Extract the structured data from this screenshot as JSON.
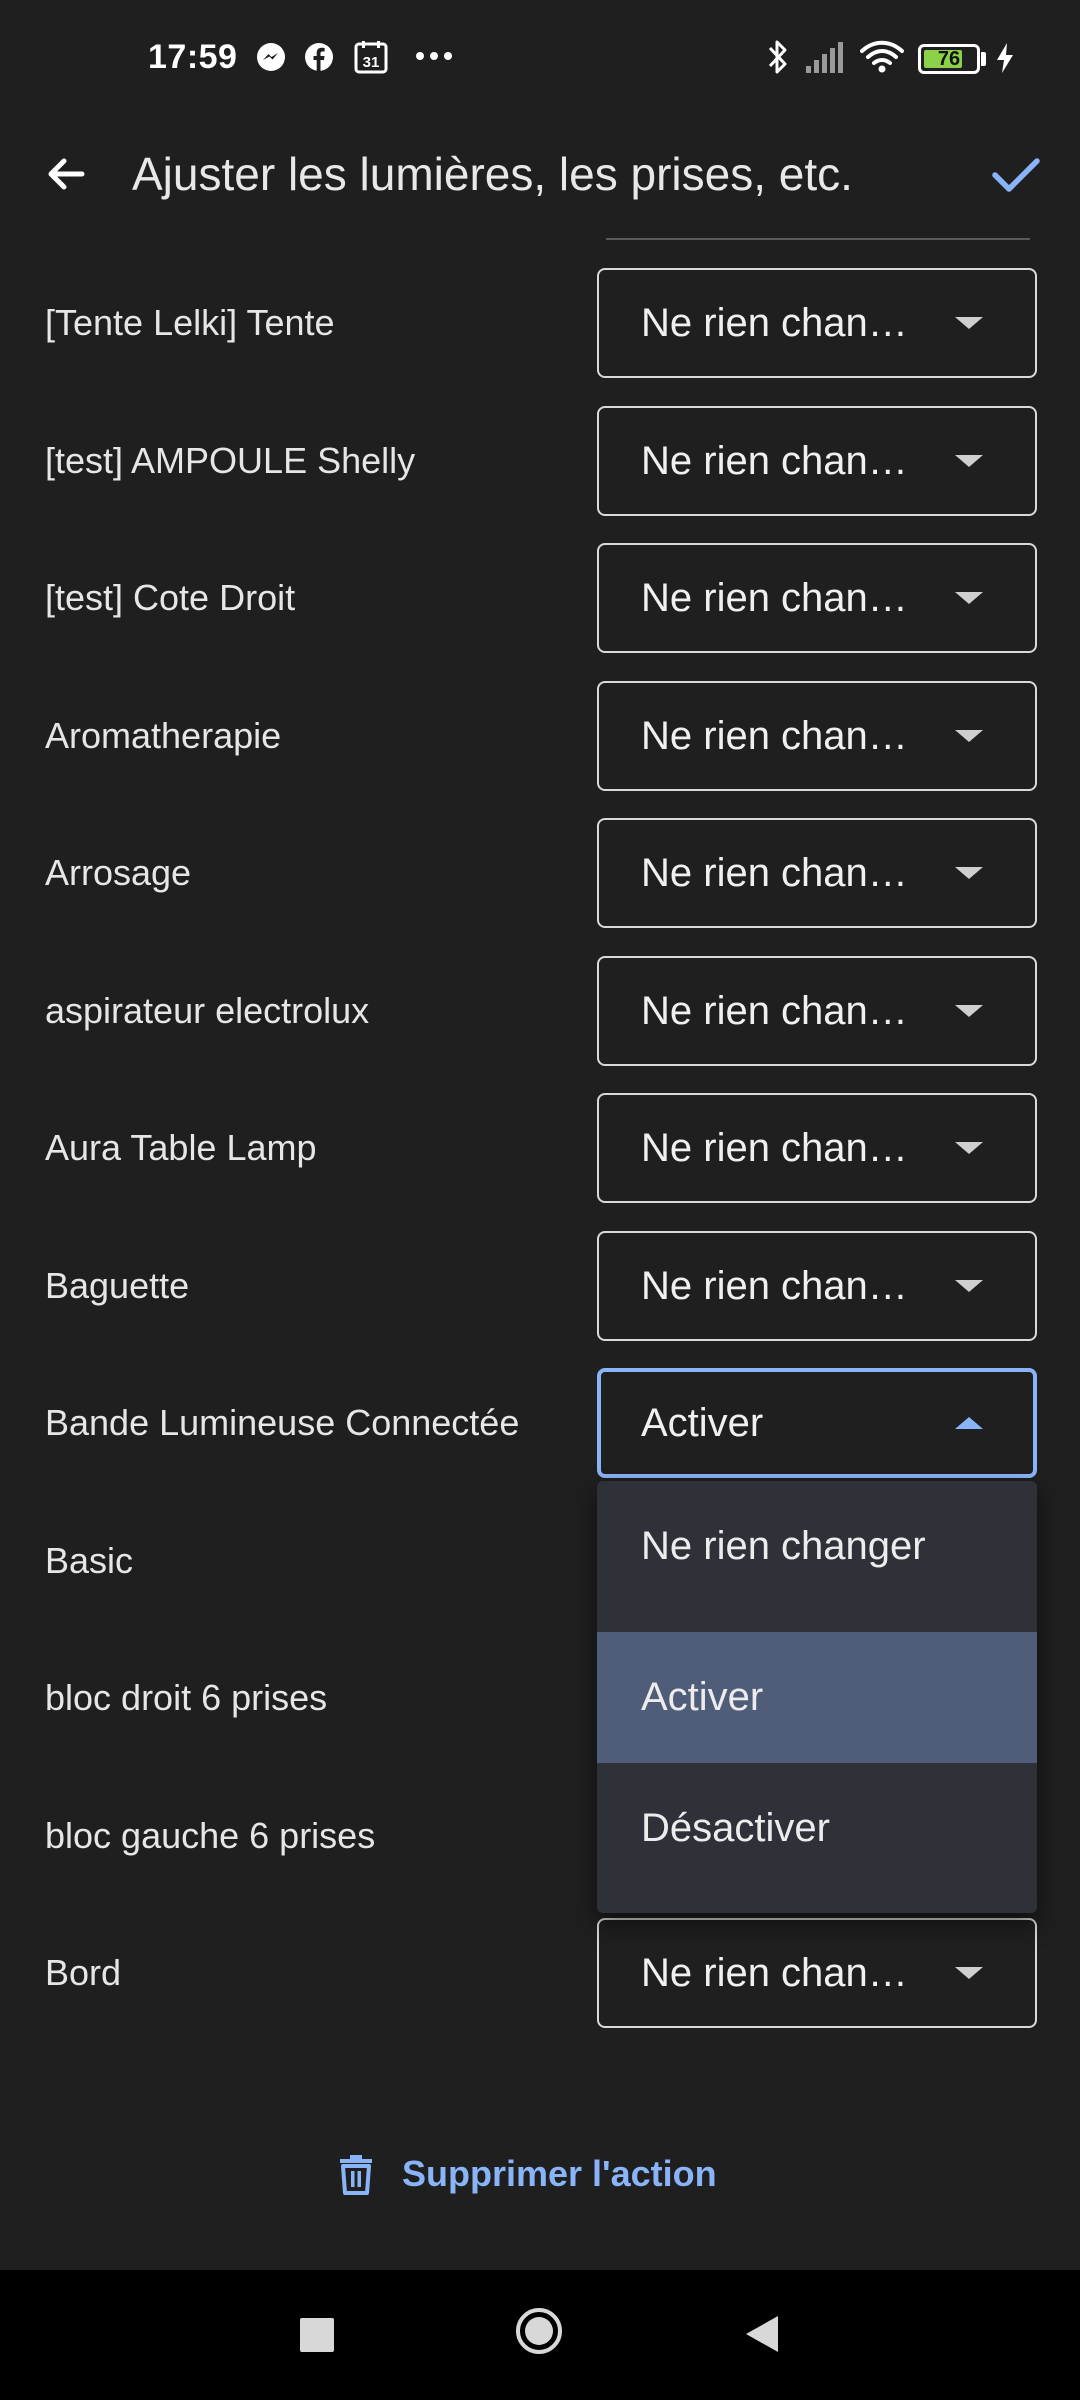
{
  "status_bar": {
    "time": "17:59",
    "battery_level": "76",
    "battery_fraction": 0.76,
    "icons": [
      "messenger-icon",
      "facebook-icon",
      "calendar-icon",
      "more-icon",
      "bluetooth-icon",
      "signal-icon",
      "wifi-icon",
      "battery-icon",
      "charging-icon"
    ],
    "calendar_day": "31"
  },
  "header": {
    "title": "Ajuster les lumières, les prises, etc.",
    "back_icon": "arrow-back-icon",
    "confirm_icon": "check-icon"
  },
  "devices": [
    {
      "label": "[Tente Lelki] Tente",
      "value": "Ne rien changer"
    },
    {
      "label": "[test] AMPOULE Shelly",
      "value": "Ne rien changer"
    },
    {
      "label": "[test] Cote Droit",
      "value": "Ne rien changer"
    },
    {
      "label": "Aromatherapie",
      "value": "Ne rien changer"
    },
    {
      "label": "Arrosage",
      "value": "Ne rien changer"
    },
    {
      "label": "aspirateur electrolux",
      "value": "Ne rien changer"
    },
    {
      "label": "Aura Table Lamp",
      "value": "Ne rien changer"
    },
    {
      "label": "Baguette",
      "value": "Ne rien changer"
    },
    {
      "label": "Bande Lumineuse Connectée",
      "value": "Activer",
      "open": true
    },
    {
      "label": "Basic",
      "value": ""
    },
    {
      "label": "bloc droit 6 prises",
      "value": ""
    },
    {
      "label": "bloc gauche 6 prises",
      "value": ""
    },
    {
      "label": "Bord",
      "value": "Ne rien changer"
    }
  ],
  "dropdown_menu": {
    "options": [
      {
        "label": "Ne rien changer",
        "selected": false
      },
      {
        "label": "Activer",
        "selected": true
      },
      {
        "label": "Désactiver",
        "selected": false
      }
    ]
  },
  "footer": {
    "delete_label": "Supprimer l'action",
    "delete_icon": "trash-icon"
  },
  "nav_bar": {
    "icons": [
      "recents-icon",
      "home-icon",
      "back-icon"
    ]
  },
  "colors": {
    "background": "#1f1f1f",
    "accent": "#8ab4f8",
    "menu_background": "#2e3137",
    "menu_selected": "#4f5d78",
    "battery_fill": "#8bd14a"
  }
}
